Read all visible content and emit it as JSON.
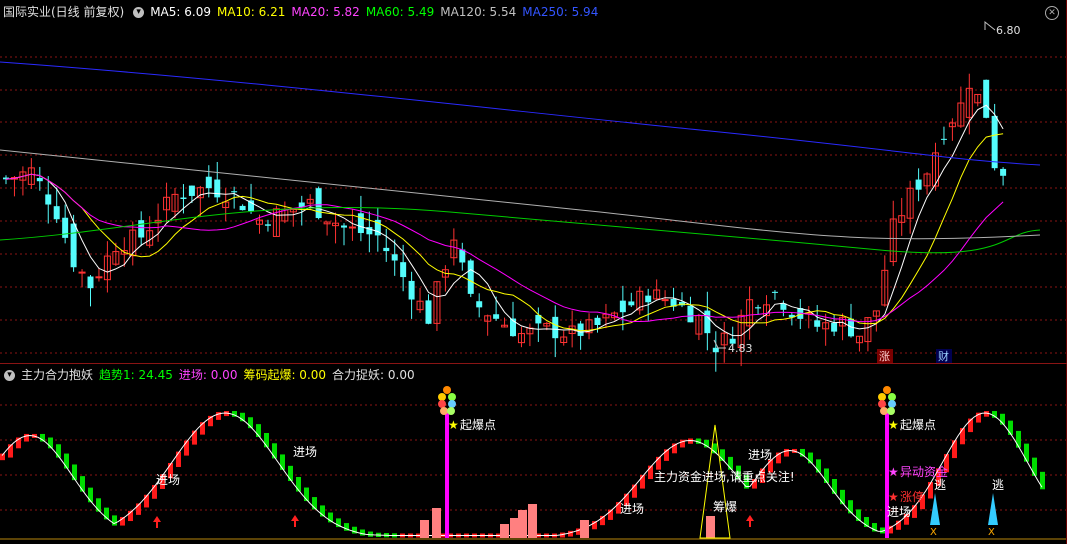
{
  "main_header": {
    "title": "国际实业(日线 前复权)",
    "indicators": [
      {
        "label": "MA5: 6.09",
        "color": "#ffffff"
      },
      {
        "label": "MA10: 6.21",
        "color": "#ffff00"
      },
      {
        "label": "MA20: 5.82",
        "color": "#ff00ff"
      },
      {
        "label": "MA60: 5.49",
        "color": "#00ff00"
      },
      {
        "label": "MA120: 5.54",
        "color": "#c0c0c0"
      },
      {
        "label": "MA250: 5.94",
        "color": "#3333ff"
      }
    ]
  },
  "sub_header": {
    "title": "主力合力抱妖",
    "indicators": [
      {
        "label": "趋势1: 24.45",
        "color": "#00ff00"
      },
      {
        "label": "进场: 0.00",
        "color": "#ff44ff"
      },
      {
        "label": "筹码起爆: 0.00",
        "color": "#ffff00"
      },
      {
        "label": "合力捉妖: 0.00",
        "color": "#e0e0e0"
      }
    ]
  },
  "price_annotations": {
    "high": "6.80",
    "low": "4.83"
  },
  "markers": {
    "zhang": "涨",
    "cai": "财"
  },
  "sub_labels": {
    "jinchang": "进场",
    "qibaodian": "起爆点",
    "choubao": "筹爆",
    "yidong": "异动资金",
    "zhangting": "涨停",
    "tao": "逃",
    "attention": "主力资金进场,请重点关注!"
  },
  "colors": {
    "up": "#ff3232",
    "down": "#54fcfc",
    "grid": "#8a1414",
    "pink": "#ff00ff",
    "bg": "#000000"
  }
}
